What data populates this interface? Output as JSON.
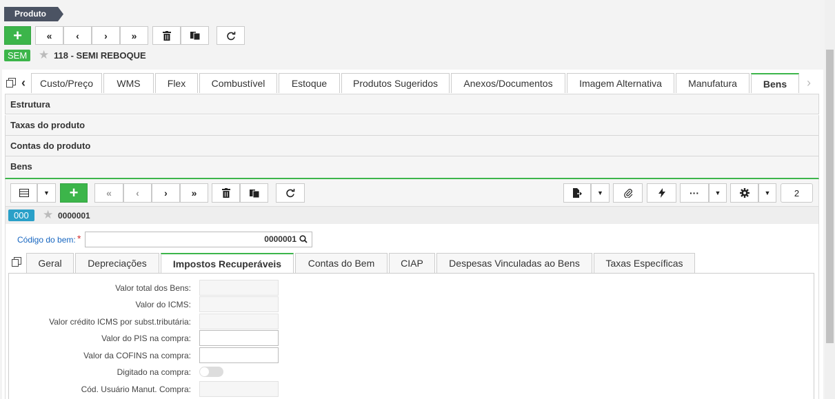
{
  "breadcrumb": {
    "label": "Produto"
  },
  "record": {
    "badge": "SEM",
    "title": "118 - SEMI REBOQUE",
    "badge_color": "#3cb54a"
  },
  "tabs": [
    {
      "label": "Custo/Preço"
    },
    {
      "label": "WMS"
    },
    {
      "label": "Flex"
    },
    {
      "label": "Combustível"
    },
    {
      "label": "Estoque"
    },
    {
      "label": "Produtos Sugeridos"
    },
    {
      "label": "Anexos/Documentos"
    },
    {
      "label": "Imagem Alternativa"
    },
    {
      "label": "Manufatura"
    },
    {
      "label": "Bens",
      "active": true
    }
  ],
  "sections": [
    {
      "label": "Estrutura"
    },
    {
      "label": "Taxas do produto"
    },
    {
      "label": "Contas do produto"
    },
    {
      "label": "Bens"
    }
  ],
  "sub_toolbar": {
    "page_input": "2"
  },
  "sub_record": {
    "badge": "000",
    "title": "0000001",
    "badge_color": "#2aa0c8"
  },
  "codigo": {
    "label": "Código do bem:",
    "required": "*",
    "value": "0000001"
  },
  "subtabs": [
    {
      "label": "Geral"
    },
    {
      "label": "Depreciações"
    },
    {
      "label": "Impostos Recuperáveis",
      "active": true
    },
    {
      "label": "Contas do Bem"
    },
    {
      "label": "CIAP"
    },
    {
      "label": "Despesas Vinculadas ao Bens"
    },
    {
      "label": "Taxas Específicas"
    }
  ],
  "form": {
    "valor_total_bens": {
      "label": "Valor total dos Bens:",
      "value": ""
    },
    "valor_icms": {
      "label": "Valor do ICMS:",
      "value": ""
    },
    "valor_credito_icms": {
      "label": "Valor crédito ICMS por subst.tributária:",
      "value": ""
    },
    "valor_pis": {
      "label": "Valor do PIS na compra:",
      "value": ""
    },
    "valor_cofins": {
      "label": "Valor da COFINS na compra:",
      "value": ""
    },
    "digitado_compra": {
      "label": "Digitado na compra:",
      "on": false
    },
    "cod_usuario": {
      "label": "Cód. Usuário Manut. Compra:",
      "value": ""
    }
  },
  "colors": {
    "accent": "#3cb54a",
    "breadcrumb": "#4b5363",
    "link": "#1565c0"
  }
}
